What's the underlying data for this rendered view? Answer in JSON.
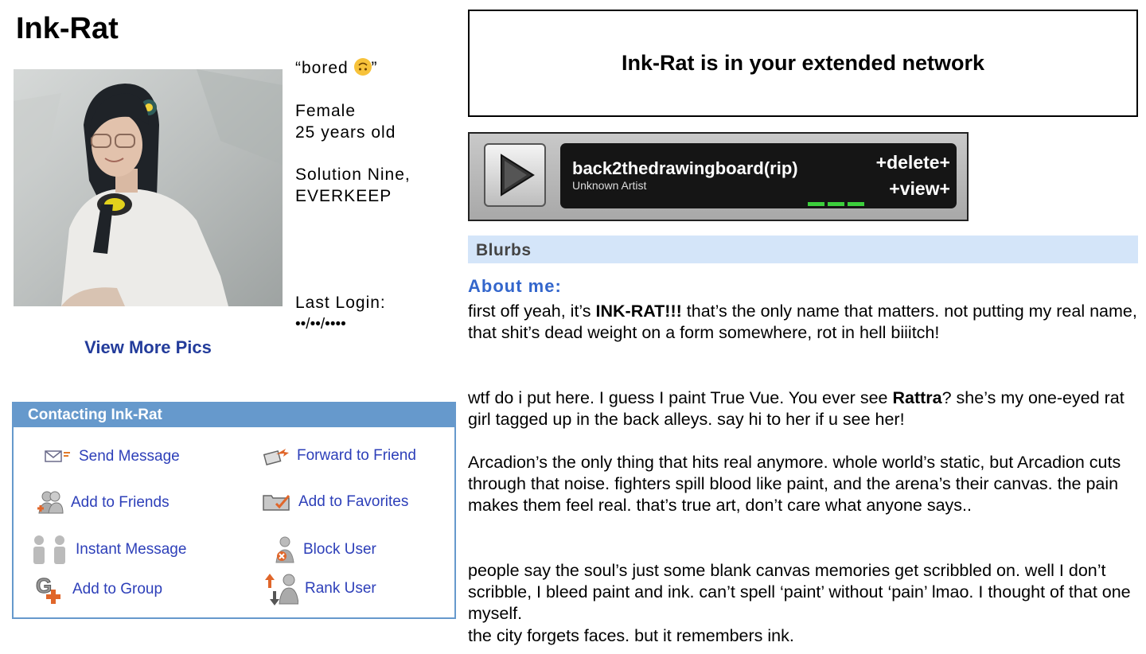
{
  "profile": {
    "name": "Ink-Rat",
    "status_open": "“bored ",
    "status_close": "”",
    "status_emoji": "upside-down-face-emoji",
    "gender": "Female",
    "age": "25 years old",
    "location_line_1": "Solution Nine,",
    "location_line_2": "EVERKEEP",
    "last_login_label": "Last Login:",
    "last_login_value": "••/••/••••",
    "view_more_pics": "View More Pics"
  },
  "contact": {
    "header": "Contacting Ink-Rat",
    "items": [
      {
        "label": "Send Message",
        "icon": "envelope-icon"
      },
      {
        "label": "Forward to Friend",
        "icon": "forward-icon"
      },
      {
        "label": "Add to Friends",
        "icon": "add-friends-icon"
      },
      {
        "label": "Add to Favorites",
        "icon": "favorites-folder-icon"
      },
      {
        "label": "Instant Message",
        "icon": "instant-message-icon"
      },
      {
        "label": "Block User",
        "icon": "block-user-icon"
      },
      {
        "label": "Add to Group",
        "icon": "add-group-icon"
      },
      {
        "label": "Rank User",
        "icon": "rank-user-icon"
      }
    ]
  },
  "network": {
    "text": "Ink-Rat is in your extended network"
  },
  "music_player": {
    "track_title": "back2thedrawingboard(rip)",
    "artist": "Unknown Artist",
    "delete_label": "+delete+",
    "view_label": "+view+"
  },
  "blurbs": {
    "header": "Blurbs",
    "about_heading": "About me:",
    "p1_before": "first off yeah, it’s ",
    "p1_bold": "INK-RAT!!!",
    "p1_after": " that’s the only name that matters. not putting my real name, that shit’s dead weight on a form somewhere, rot in hell biiitch!",
    "p2_before": "wtf do i put here. I guess I paint True Vue. You ever see ",
    "p2_bold": "Rattra",
    "p2_after": "? she’s my one-eyed rat girl tagged up in the back alleys. say hi to her if u see her!",
    "p3": "Arcadion’s the only thing that hits real anymore. whole world’s static, but Arcadion cuts through that noise. fighters spill blood like paint, and the arena’s their canvas. the pain makes them feel real. that’s true art, don’t care what anyone says..",
    "p4_line_1": "people say the soul’s just some blank canvas memories get scribbled on. well I don’t scribble, I bleed paint and ink. can’t spell ‘paint’ without ‘pain’ lmao. I thought of that one myself.",
    "p4_line_2": "the city forgets faces. but it remembers ink."
  },
  "colors": {
    "link_blue": "#233c9b",
    "contact_blue": "#6699cc",
    "blurbs_bg": "#d4e5f9",
    "about_blue": "#3366cc"
  }
}
